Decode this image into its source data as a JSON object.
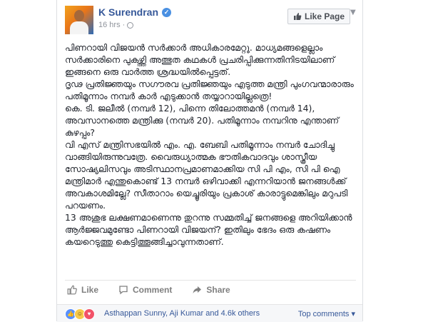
{
  "post": {
    "author": "K Surendran",
    "timestamp": "16 hrs",
    "like_page_label": "Like Page",
    "paragraphs": [
      "പിണറായി വിജയൻ സർക്കാർ അധികാരമേറ്റു. മാധ്യമങ്ങളെല്ലാം സർക്കാരിനെ പുകഴ്ത്തി അത്ഭുത കഥകൾ പ്രചരിപ്പിക്കുന്നതിനിടയിലാണ് ഇങ്ങനെ ഒരു വാർത്ത ശ്രദ്ധയിൽപ്പെട്ടത്.",
      "ദൃഢ പ്രതിജ്ഞയും സഗൗരവ പ്രതിജ്ഞയും എടുത്ത മന്ത്രി പുംഗവന്മാരാരും പതിമൂന്നാം നമ്പർ കാർ എടുക്കാൻ തയ്യാറായില്ലത്രെ!",
      "കെ. ടി. ജലീൽ (നമ്പർ 12), പിന്നെ തിലോത്തമൻ (നമ്പർ 14), അവസാനത്തെ മന്ത്രിക്കു (നമ്പർ 20). പതിമൂന്നാം നമ്പറിനു എന്താണ് കുഴപ്പം?",
      "വി എസ് മന്ത്രിസഭയിൽ എം. എ. ബേബി പതിമൂന്നാം നമ്പർ ചോദിച്ചു വാങ്ങിയിരുന്നുവത്രേ. വൈരുധ്യാത്മക ഭൗതികവാദവും ശാസ്ത്രീയ സോഷ്യലിസവും അടിസ്ഥാനപ്രമാണമാക്കിയ സി പി എം, സി പി ഐ മന്ത്രിമാർ എന്തുകൊണ്ട് 13 നമ്പർ ഒഴിവാക്കി എന്നറിയാൻ ജനങ്ങൾക്ക് അവകാശമില്ലേ? സീതാറാം യെച്ചൂരിയും പ്രകാശ് കാരാട്ടുമെങ്കിലും മറുപടി പറയണം.",
      "13 അശുഭ ലക്ഷണമാണെന്നു തുറന്നു സമ്മതിച്ച് ജനങ്ങളെ അറിയിക്കാൻ ആർജ്ജവമുണ്ടോ പിണറായി വിജയന്? ഇതിലും ഭേദം ഒരു കഷണം കയറെടുത്തു കെട്ടിത്തൂങ്ങിച്ചാവുന്നതാണ്."
    ]
  },
  "actions": {
    "like": "Like",
    "comment": "Comment",
    "share": "Share"
  },
  "reactions": {
    "summary": "Asthappan Sunny, Aji Kumar and 4.6k others",
    "top_comments": "Top comments ▾"
  },
  "colors": {
    "link": "#365899",
    "text": "#1d2129",
    "muted": "#90949c"
  }
}
